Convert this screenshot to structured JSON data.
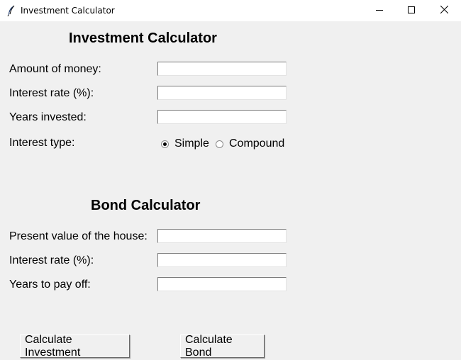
{
  "window": {
    "title": "Investment Calculator",
    "icon": "feather-icon",
    "controls": {
      "minimize_icon": "minimize-icon",
      "maximize_icon": "maximize-icon",
      "close_icon": "close-icon"
    }
  },
  "investment": {
    "heading": "Investment Calculator",
    "amount_label": "Amount of money:",
    "amount_value": "",
    "rate_label": "Interest rate (%):",
    "rate_value": "",
    "years_label": "Years invested:",
    "years_value": "",
    "type_label": "Interest type:",
    "type_options": [
      "Simple",
      "Compound"
    ],
    "type_selected": "Simple"
  },
  "bond": {
    "heading": "Bond Calculator",
    "house_label": "Present value of the house:",
    "house_value": "",
    "rate_label": "Interest rate (%):",
    "rate_value": "",
    "years_label": "Years to pay off:",
    "years_value": ""
  },
  "buttons": {
    "calc_investment": "Calculate Investment",
    "calc_bond": "Calculate Bond"
  }
}
